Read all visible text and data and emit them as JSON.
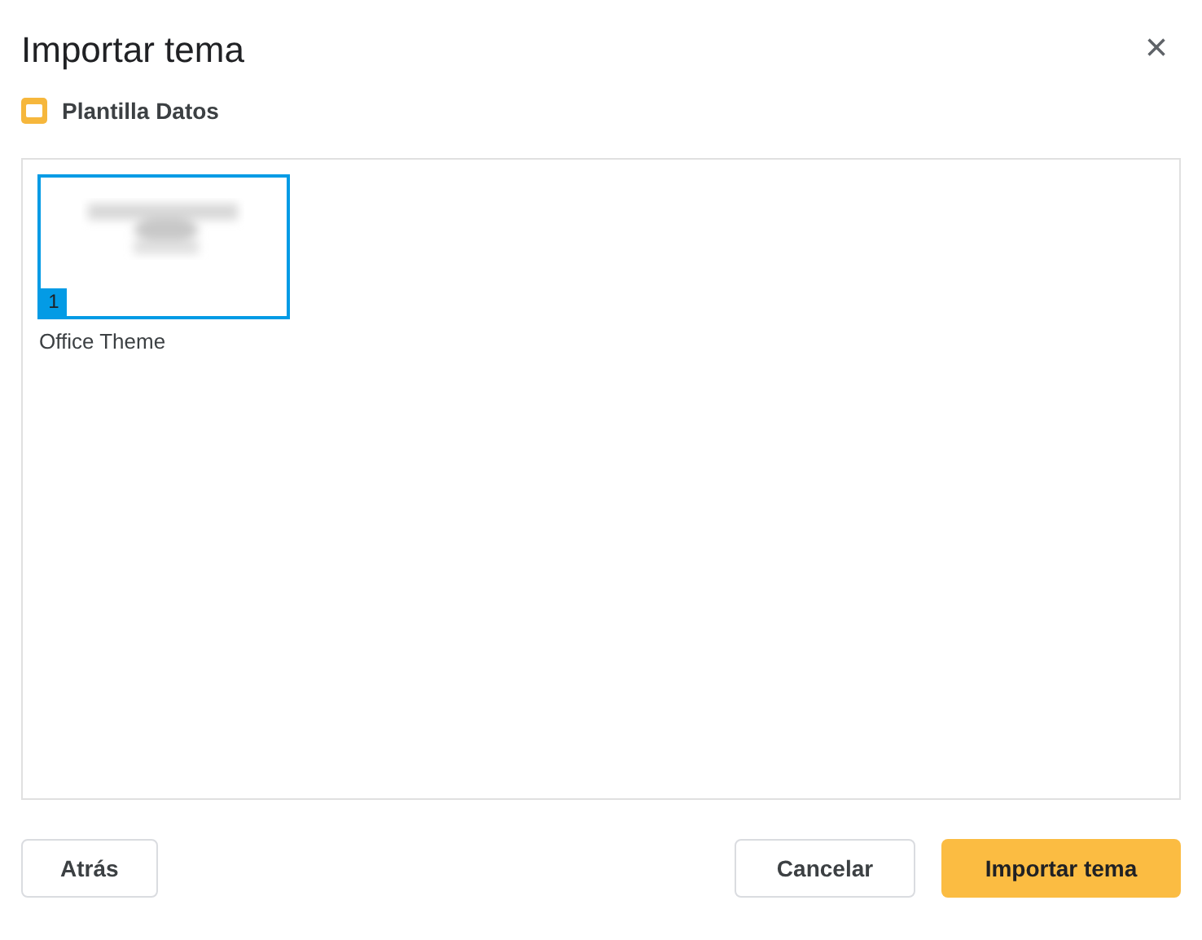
{
  "dialog": {
    "title": "Importar tema",
    "close": "×"
  },
  "file": {
    "name": "Plantilla Datos"
  },
  "themes": [
    {
      "number": "1",
      "name": "Office Theme",
      "selected": true,
      "kind": "picture"
    }
  ],
  "buttons": {
    "back": "Atrás",
    "cancel": "Cancelar",
    "import": "Importar tema"
  }
}
